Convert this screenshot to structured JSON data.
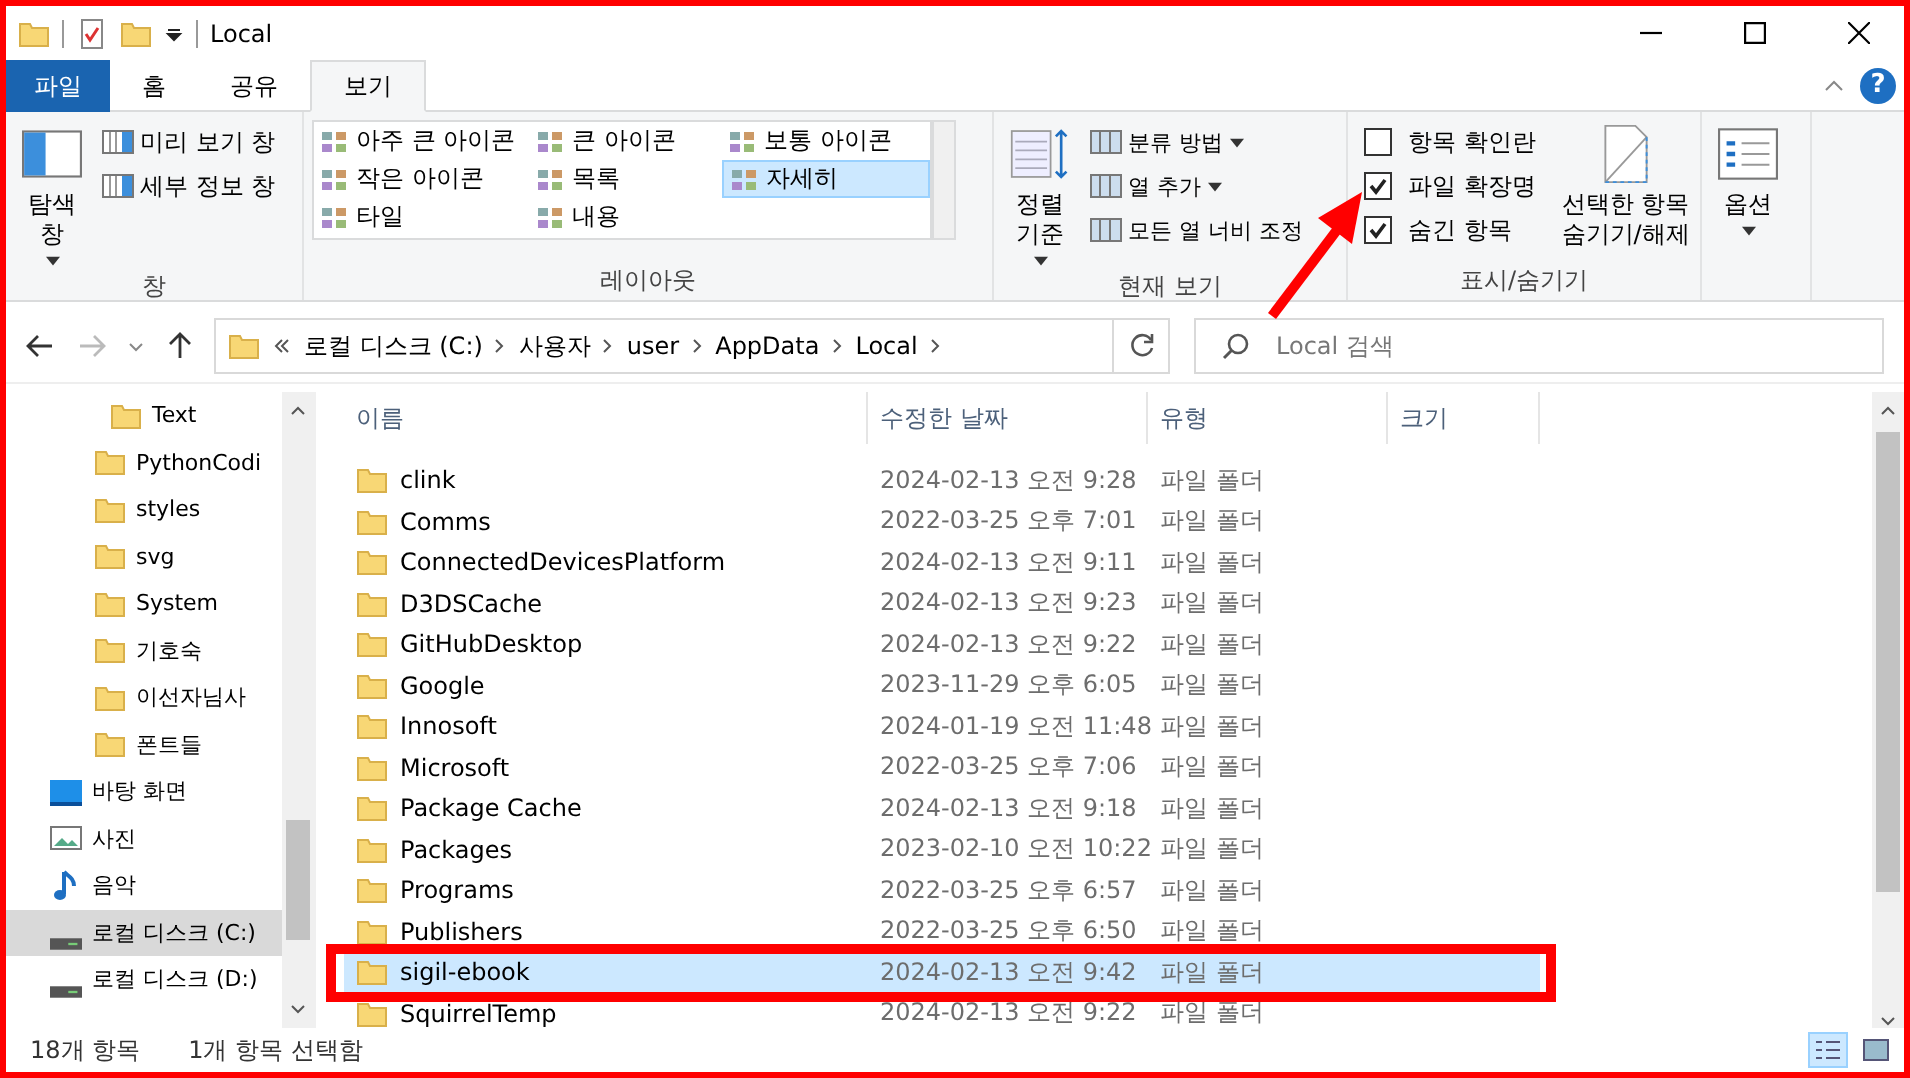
{
  "window": {
    "title": "Local"
  },
  "help_button": "?",
  "ribbon_tabs": [
    {
      "label": "파일",
      "kind": "file",
      "selected": false
    },
    {
      "label": "홈",
      "kind": "tab",
      "selected": false
    },
    {
      "label": "공유",
      "kind": "tab",
      "selected": false
    },
    {
      "label": "보기",
      "kind": "tab",
      "selected": true
    }
  ],
  "pane_group": {
    "label": "창",
    "nav_pane": "탐색 창",
    "buttons": [
      "미리 보기 창",
      "세부 정보 창"
    ]
  },
  "layout_group": {
    "label": "레이아웃",
    "options": [
      {
        "label": "아주 큰 아이콘",
        "selected": false
      },
      {
        "label": "큰 아이콘",
        "selected": false
      },
      {
        "label": "보통 아이콘",
        "selected": false
      },
      {
        "label": "작은 아이콘",
        "selected": false
      },
      {
        "label": "목록",
        "selected": false
      },
      {
        "label": "자세히",
        "selected": true
      },
      {
        "label": "타일",
        "selected": false
      },
      {
        "label": "내용",
        "selected": false
      }
    ]
  },
  "current_view_group": {
    "label": "현재 보기",
    "sort": "정렬 기준",
    "buttons": [
      "분류 방법",
      "열 추가",
      "모든 열 너비 조정"
    ]
  },
  "show_hide_group": {
    "label": "표시/숨기기",
    "checkboxes": [
      {
        "label": "항목 확인란",
        "checked": false
      },
      {
        "label": "파일 확장명",
        "checked": true
      },
      {
        "label": "숨긴 항목",
        "checked": true
      }
    ],
    "hide_selected": "선택한 항목 숨기기/해제"
  },
  "options_button": "옵션",
  "address_bar": {
    "path": [
      "로컬 디스크 (C:)",
      "사용자",
      "user",
      "AppData",
      "Local"
    ]
  },
  "search": {
    "placeholder": "Local 검색"
  },
  "nav_tree": [
    {
      "label": "Text",
      "kind": "folder",
      "selected": false
    },
    {
      "label": "PythonCodi",
      "kind": "folder",
      "selected": false
    },
    {
      "label": "styles",
      "kind": "folder",
      "selected": false
    },
    {
      "label": "svg",
      "kind": "folder",
      "selected": false
    },
    {
      "label": "System",
      "kind": "folder",
      "selected": false
    },
    {
      "label": "기호숙",
      "kind": "folder",
      "selected": false
    },
    {
      "label": "이선자님사",
      "kind": "folder",
      "selected": false
    },
    {
      "label": "폰트들",
      "kind": "folder",
      "selected": false
    },
    {
      "label": "바탕 화면",
      "kind": "desktop",
      "selected": false
    },
    {
      "label": "사진",
      "kind": "pictures",
      "selected": false
    },
    {
      "label": "음악",
      "kind": "music",
      "selected": false
    },
    {
      "label": "로컬 디스크 (C:)",
      "kind": "drive",
      "selected": true
    },
    {
      "label": "로컬 디스크 (D:)",
      "kind": "drive",
      "selected": false
    }
  ],
  "files": {
    "columns": [
      "이름",
      "수정한 날짜",
      "유형",
      "크기"
    ],
    "rows": [
      {
        "name": "clink",
        "modified": "2024-02-13 오전 9:28",
        "type": "파일 폴더",
        "selected": false
      },
      {
        "name": "Comms",
        "modified": "2022-03-25 오후 7:01",
        "type": "파일 폴더",
        "selected": false
      },
      {
        "name": "ConnectedDevicesPlatform",
        "modified": "2024-02-13 오전 9:11",
        "type": "파일 폴더",
        "selected": false
      },
      {
        "name": "D3DSCache",
        "modified": "2024-02-13 오전 9:23",
        "type": "파일 폴더",
        "selected": false
      },
      {
        "name": "GitHubDesktop",
        "modified": "2024-02-13 오전 9:22",
        "type": "파일 폴더",
        "selected": false
      },
      {
        "name": "Google",
        "modified": "2023-11-29 오후 6:05",
        "type": "파일 폴더",
        "selected": false
      },
      {
        "name": "Innosoft",
        "modified": "2024-01-19 오전 11:48",
        "type": "파일 폴더",
        "selected": false
      },
      {
        "name": "Microsoft",
        "modified": "2022-03-25 오후 7:06",
        "type": "파일 폴더",
        "selected": false
      },
      {
        "name": "Package Cache",
        "modified": "2024-02-13 오전 9:18",
        "type": "파일 폴더",
        "selected": false
      },
      {
        "name": "Packages",
        "modified": "2023-02-10 오전 10:22",
        "type": "파일 폴더",
        "selected": false
      },
      {
        "name": "Programs",
        "modified": "2022-03-25 오후 6:57",
        "type": "파일 폴더",
        "selected": false
      },
      {
        "name": "Publishers",
        "modified": "2022-03-25 오후 6:50",
        "type": "파일 폴더",
        "selected": false
      },
      {
        "name": "sigil-ebook",
        "modified": "2024-02-13 오전 9:42",
        "type": "파일 폴더",
        "selected": true
      },
      {
        "name": "SquirrelTemp",
        "modified": "2024-02-13 오전 9:22",
        "type": "파일 폴더",
        "selected": false
      }
    ]
  },
  "status_bar": {
    "count": "18개 항목",
    "selection": "1개 항목 선택함"
  }
}
